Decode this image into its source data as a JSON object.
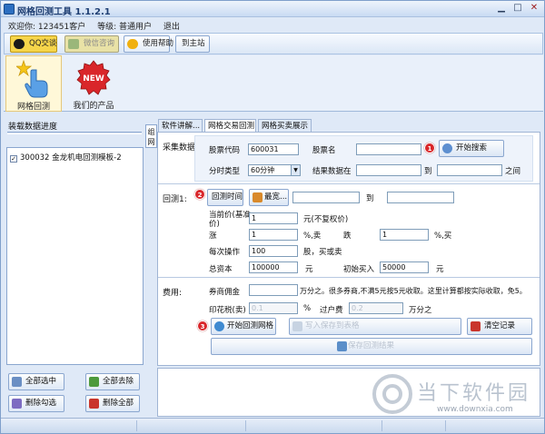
{
  "window": {
    "title": "网格回测工具 1.1.2.1"
  },
  "welcome": {
    "greeting": "欢迎你: 123451客户",
    "level": "等级: 普通用户",
    "logout": "退出"
  },
  "toolbar": {
    "qq": "QQ交谈",
    "wechat": "微信咨询",
    "help": "使用帮助",
    "home": "到主站"
  },
  "bigbar": {
    "backtest": "网格回测",
    "products": "我们的产品",
    "new_badge": "NEW"
  },
  "left": {
    "title": "装载数据进度",
    "list_items": [
      "300032 金龙机电回测模板-2"
    ],
    "select_all": "全部选中",
    "remove_all": "全部去除",
    "delete_checked": "删除勾选",
    "delete_all": "删除全部"
  },
  "side_tab": "组网",
  "tabs": [
    "软件讲解...",
    "网格交易回测",
    "网格买卖展示"
  ],
  "collect": {
    "label": "采集数据",
    "stock_code_label": "股票代码",
    "stock_code": "600031",
    "stock_name_label": "股票名",
    "stock_name": "",
    "search_button": "开始搜索",
    "period_label": "分时类型",
    "period": "60分钟",
    "result_label": "结果数据在",
    "to_label": "到",
    "between_label": "之间",
    "result_from": "",
    "result_to": ""
  },
  "backtest": {
    "label": "回测1:",
    "time_button": "回测时间",
    "width_button": "最宽...",
    "time_from": "",
    "time_to_label": "到",
    "time_to": "",
    "price_label": "当前价(基准价)",
    "price": "1",
    "price_unit": "元(不复权价)",
    "rise_label": "涨",
    "rise": "1",
    "rise_unit": "%,卖",
    "fall_label": "跌",
    "fall": "1",
    "fall_unit": "%,买",
    "per_trade_label": "每次操作",
    "per_trade": "100",
    "per_trade_unit": "股，买或卖",
    "capital_label": "总资本",
    "capital": "100000",
    "capital_unit": "元",
    "initial_label": "初始买入",
    "initial": "50000",
    "initial_unit": "元"
  },
  "fees": {
    "label": "费用:",
    "commission_label": "券商佣金",
    "commission": "",
    "commission_note": "万分之。很多券商,不满5元按5元收取。这里计算都按实际收取，免5。",
    "stamp_label": "印花税(卖)",
    "stamp": "0.1",
    "stamp_unit": "%",
    "transfer_label": "过户费",
    "transfer": "0.2",
    "transfer_unit": "万分之",
    "start_button": "开始回测网格",
    "export_button": "写入保存到表格",
    "clear_button": "清空记录",
    "save_button": "保存回测结果"
  },
  "badges": [
    "1",
    "2",
    "3"
  ],
  "watermark": {
    "text": "当下软件园",
    "url": "www.downxia.com"
  },
  "colors": {
    "accent": "#2c6fc1",
    "badge": "#d9262a",
    "qq_button": "#f6d54a"
  }
}
